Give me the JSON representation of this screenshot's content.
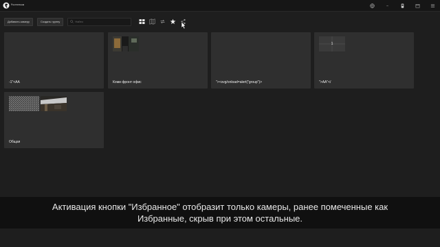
{
  "header": {
    "brand": "Ростелеком",
    "icons": [
      "globe-icon",
      "dash-icon",
      "device-icon",
      "calendar-icon",
      "menu-icon"
    ]
  },
  "toolbar": {
    "add_camera": "Добавить камеру",
    "create_group": "Создать группу",
    "search_placeholder": "Найти",
    "icons": [
      "grid-view-icon",
      "map-icon",
      "sync-icon",
      "favorite-star-icon",
      "share-icon"
    ]
  },
  "groups": [
    {
      "label": "-1\"<AA"
    },
    {
      "label": "Коми фронт офис"
    },
    {
      "label": "\"><svg/onload=alert(\"group\")>"
    },
    {
      "label": "\">AA\"</"
    },
    {
      "label": "Общая"
    }
  ],
  "group_badge": "1",
  "subtitle": {
    "line1": "Активация кнопки \"Избранное\" отобразит только камеры, ранее помеченные как",
    "line2": "Избранные, скрыв при этом остальные."
  },
  "colors": {
    "background": "#1e1e1e",
    "card": "#2f2f2f",
    "accent": "#e0e0e0"
  }
}
